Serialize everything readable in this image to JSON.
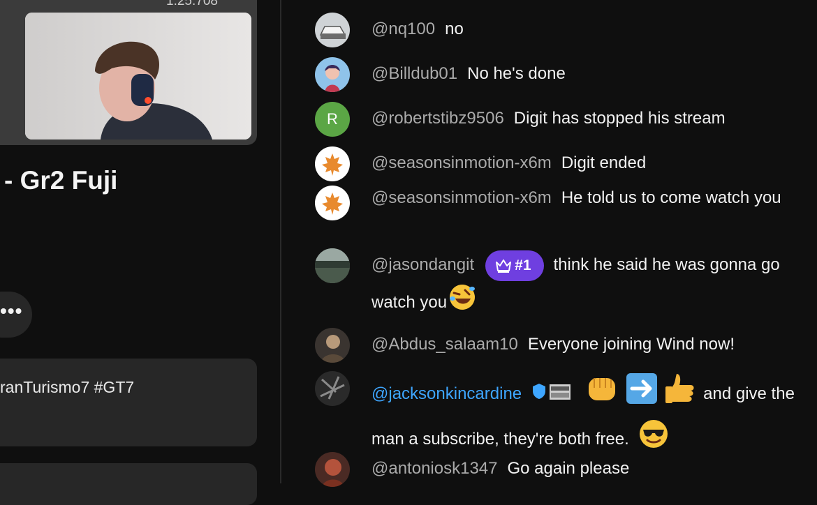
{
  "video": {
    "timer": "1:25.708",
    "title": "- Gr2 Fuji",
    "more_label": "•••",
    "hashtags": "ranTurismo7 #GT7"
  },
  "chat": {
    "messages": [
      {
        "author": "@nq100",
        "text": "no",
        "avatar": "car-avatar"
      },
      {
        "author": "@Billdub01",
        "text": "No he's done",
        "avatar": "anime-avatar"
      },
      {
        "author": "@robertstibz9506",
        "text": "Digit has stopped his stream",
        "avatar": "letter-avatar",
        "avatar_letter": "R",
        "avatar_color": "#5ba645"
      },
      {
        "author": "@seasonsinmotion-x6m",
        "text": "Digit ended",
        "avatar": "maple-leaf-avatar"
      },
      {
        "author": "@seasonsinmotion-x6m",
        "text": "He told us to come watch you",
        "avatar": "maple-leaf-avatar"
      },
      {
        "author": "@jasondangit",
        "badge": "#1",
        "text": "think he said he was gonna go watch you",
        "emoji": "rolling-on-floor-laughing-emoji",
        "avatar": "landscape-avatar"
      },
      {
        "author": "@Abdus_salaam10",
        "text": "Everyone joining Wind now!",
        "avatar": "photo-avatar"
      },
      {
        "author": "@jacksonkincardine",
        "text": "and give the man a subscribe, they're both free.",
        "emoji": "sunglasses-emoji",
        "avatar": "dark-photo-avatar",
        "icons": [
          "verified-shield-icon",
          "member-badge-icon",
          "punch-emoji",
          "right-arrow-emoji",
          "thumbs-up-emoji"
        ]
      },
      {
        "author": "@antoniosk1347",
        "text": "Go again please",
        "avatar": "red-photo-avatar"
      }
    ]
  },
  "colors": {
    "background": "#0f0f0f",
    "author": "#aaaaaa",
    "member_author": "#3ea6ff",
    "rank_badge": "#6f3fe0"
  }
}
